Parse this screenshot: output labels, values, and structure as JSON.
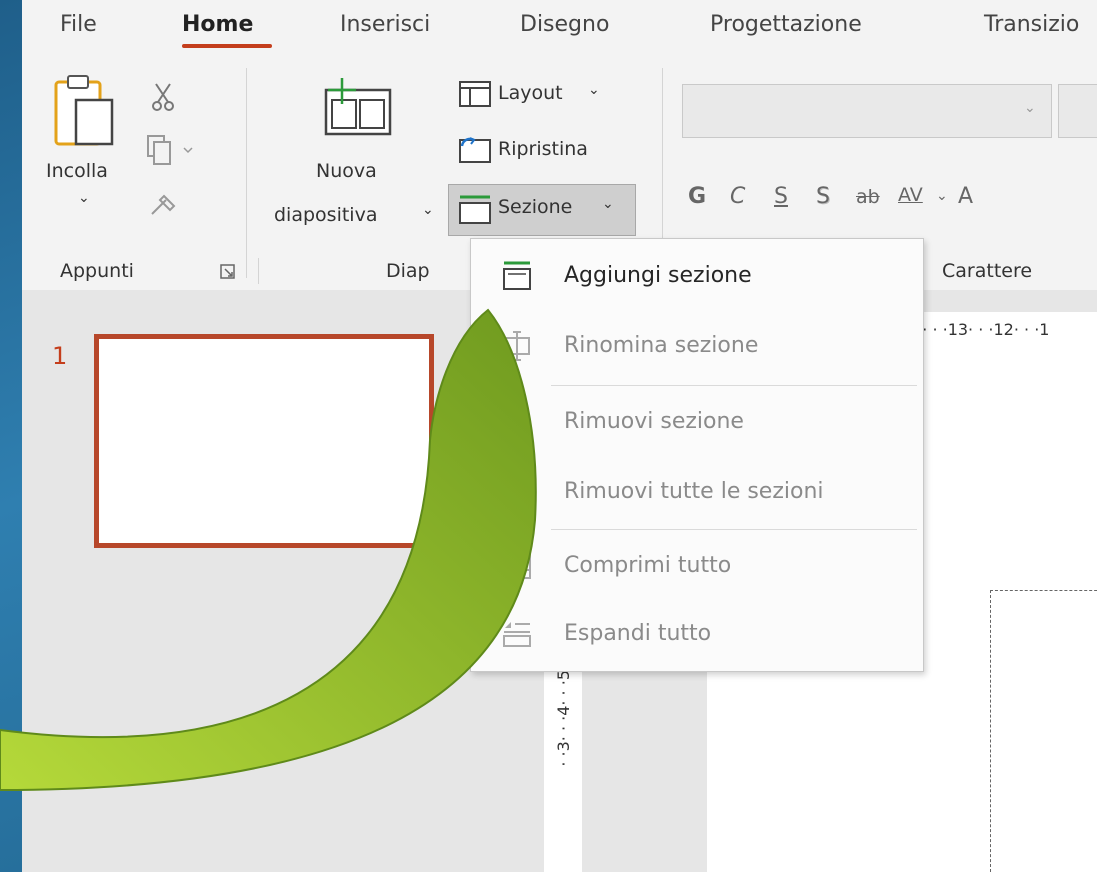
{
  "tabs": [
    "File",
    "Home",
    "Inserisci",
    "Disegno",
    "Progettazione",
    "Transizio"
  ],
  "ribbon": {
    "paste_label": "Incolla",
    "new_slide_label1": "Nuova",
    "new_slide_label2": "diapositiva",
    "layout_label": "Layout",
    "reset_label": "Ripristina",
    "section_label": "Sezione",
    "group_clipboard": "Appunti",
    "group_slides": "Diap",
    "group_font": "Carattere",
    "format_buttons": [
      "G",
      "C",
      "S",
      "S",
      "ab",
      "AV",
      "A"
    ]
  },
  "slides": {
    "thumb_number": "1"
  },
  "ruler": {
    "horizontal": "4 · · ·13· · ·12· · ·1",
    "vertical": "· ·3· · ·4· · ·5"
  },
  "section_menu": {
    "items": [
      {
        "label": "Aggiungi sezione",
        "enabled": true,
        "icon": "add-section-icon"
      },
      {
        "label": "Rinomina sezione",
        "enabled": false,
        "icon": "rename-section-icon"
      },
      {
        "label": "Rimuovi sezione",
        "enabled": false,
        "icon": "remove-section-icon"
      },
      {
        "label": "Rimuovi tutte le sezioni",
        "enabled": false,
        "icon": "remove-all-sections-icon"
      },
      {
        "label": "Comprimi tutto",
        "enabled": false,
        "icon": "collapse-all-icon"
      },
      {
        "label": "Espandi tutto",
        "enabled": false,
        "icon": "expand-all-icon"
      }
    ]
  },
  "colors": {
    "accent": "#c43e1c",
    "arrow": "#8db32b",
    "background": "#1f5f8a"
  }
}
